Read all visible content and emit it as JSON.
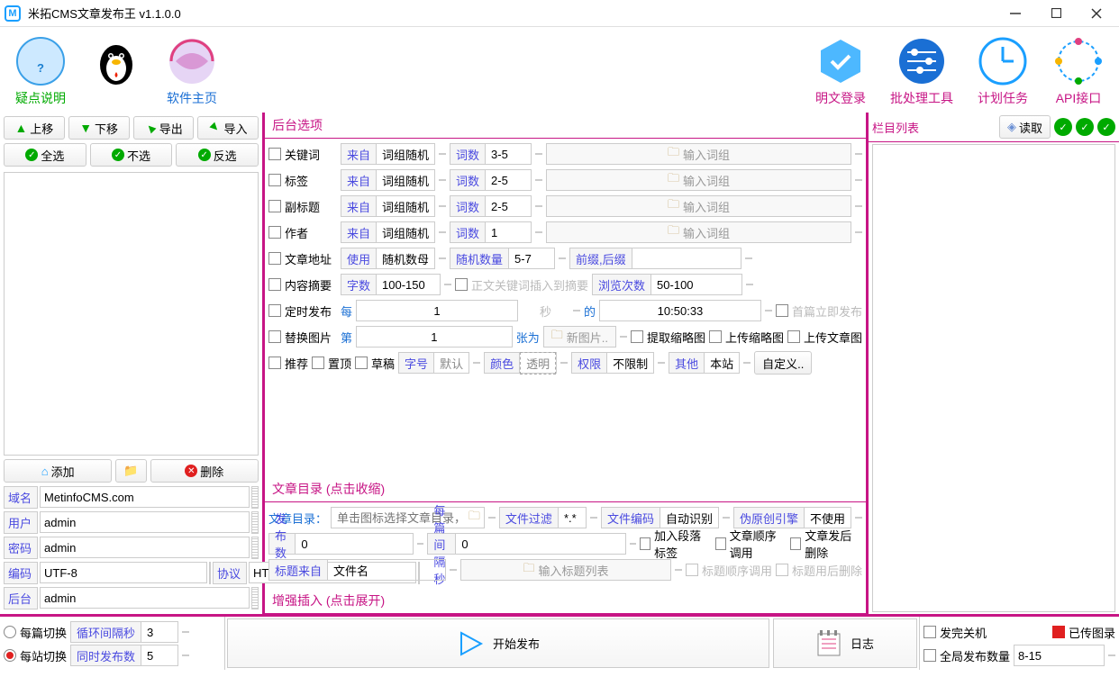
{
  "title": "米拓CMS文章发布王 v1.1.0.0",
  "nav": {
    "help": "疑点说明",
    "home": "软件主页",
    "login": "明文登录",
    "batch": "批处理工具",
    "sched": "计划任务",
    "api": "API接口"
  },
  "left": {
    "up": "上移",
    "down": "下移",
    "export": "导出",
    "import": "导入",
    "selall": "全选",
    "selnone": "不选",
    "selinv": "反选",
    "add": "添加",
    "del": "删除",
    "domain_lbl": "域名",
    "domain": "MetinfoCMS.com",
    "user_lbl": "用户",
    "user": "admin",
    "pass_lbl": "密码",
    "pass": "admin",
    "enc_lbl": "编码",
    "enc": "UTF-8",
    "proto_lbl": "协议",
    "proto": "HTTP",
    "admin_lbl": "后台",
    "admin": "admin"
  },
  "bg": {
    "hdr": "后台选项",
    "keyword": "关键词",
    "tag": "标签",
    "subtitle": "副标题",
    "author": "作者",
    "from": "来自",
    "random": "词组随机",
    "count": "词数",
    "v35": "3-5",
    "v25": "2-5",
    "v1": "1",
    "inputwords": "输入词组",
    "arturl": "文章地址",
    "use": "使用",
    "randalpha": "随机数母",
    "randcount": "随机数量",
    "v57": "5-7",
    "prefsuf": "前缀,后缀",
    "summary": "内容摘要",
    "chars": "字数",
    "v100150": "100-150",
    "kwsummary": "正文关键词插入到摘要",
    "views": "浏览次数",
    "v50100": "50-100",
    "sched": "定时发布",
    "every": "每",
    "v_every": "1",
    "sec": "秒",
    "at": "的",
    "time": "10:50:33",
    "firstnow": "首篇立即发布",
    "replimg": "替换图片",
    "nth": "第",
    "v_nth": "1",
    "imgas": "张为",
    "newimg": "新图片..",
    "extthumb": "提取缩略图",
    "upthumb": "上传缩略图",
    "upartimg": "上传文章图",
    "rec": "推荐",
    "top": "置顶",
    "draft": "草稿",
    "fontsize": "字号",
    "default": "默认",
    "color": "颜色",
    "trans": "透明",
    "perm": "权限",
    "nolimit": "不限制",
    "other": "其他",
    "thissite": "本站",
    "custom": "自定义.."
  },
  "tree": {
    "hdr": "栏目列表",
    "read": "读取"
  },
  "art": {
    "hdr": "文章目录 (点击收缩)",
    "dirlbl": "文章目录：",
    "dirph": "单击图标选择文章目录，右击图标选择文件",
    "filter": "文件过滤",
    "filterval": "*.*",
    "fileenc": "文件编码",
    "autoenc": "自动识别",
    "pseudo": "伪原创引擎",
    "notuse": "不使用",
    "pubcount": "发布数量",
    "v0": "0",
    "interval": "每篇间隔秒",
    "addpara": "加入段落标签",
    "shuffle": "文章顺序调用",
    "delafter": "文章发后删除",
    "titlesrc": "标题来自",
    "filename": "文件名",
    "titlelist": "输入标题列表",
    "titleshuffle": "标题顺序调用",
    "titledelafter": "标题用后删除",
    "enhance": "增强插入 (点击展开)"
  },
  "foot": {
    "perart": "每篇切换",
    "cycle": "循环间隔秒",
    "v3": "3",
    "persite": "每站切换",
    "concurrent": "同时发布数",
    "v5": "5",
    "start": "开始发布",
    "log": "日志",
    "shutdown": "发完关机",
    "uploaded": "已传图录",
    "global": "全局发布数量",
    "v815": "8-15"
  }
}
